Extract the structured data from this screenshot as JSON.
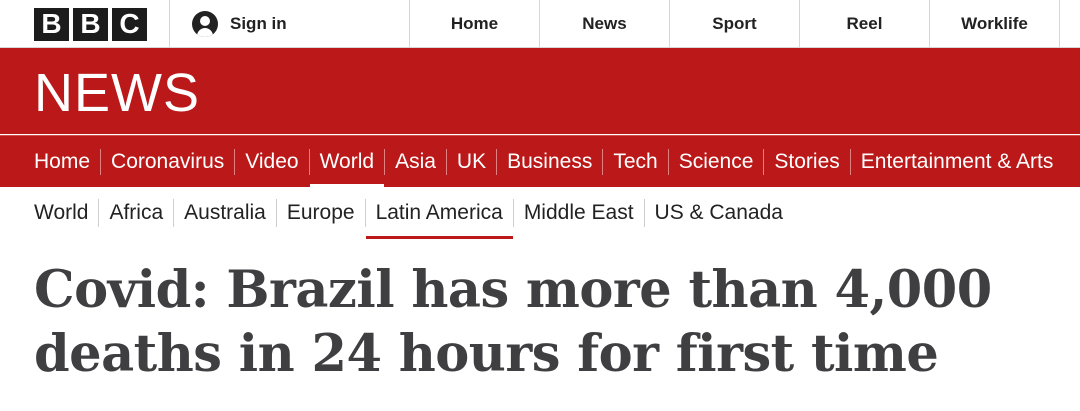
{
  "brand": {
    "letters": [
      "B",
      "B",
      "C"
    ]
  },
  "account": {
    "signin_label": "Sign in"
  },
  "top_nav": [
    "Home",
    "News",
    "Sport",
    "Reel",
    "Worklife"
  ],
  "section": {
    "title": "NEWS"
  },
  "main_nav": [
    "Home",
    "Coronavirus",
    "Video",
    "World",
    "Asia",
    "UK",
    "Business",
    "Tech",
    "Science",
    "Stories",
    "Entertainment & Arts"
  ],
  "main_nav_active": "World",
  "sub_nav": [
    "World",
    "Africa",
    "Australia",
    "Europe",
    "Latin America",
    "Middle East",
    "US & Canada"
  ],
  "sub_nav_active": "Latin America",
  "article": {
    "headline": "Covid: Brazil has more than 4,000 deaths in 24 hours for first time"
  },
  "colors": {
    "brand_red": "#bb1919",
    "headline": "#3f3f42"
  }
}
